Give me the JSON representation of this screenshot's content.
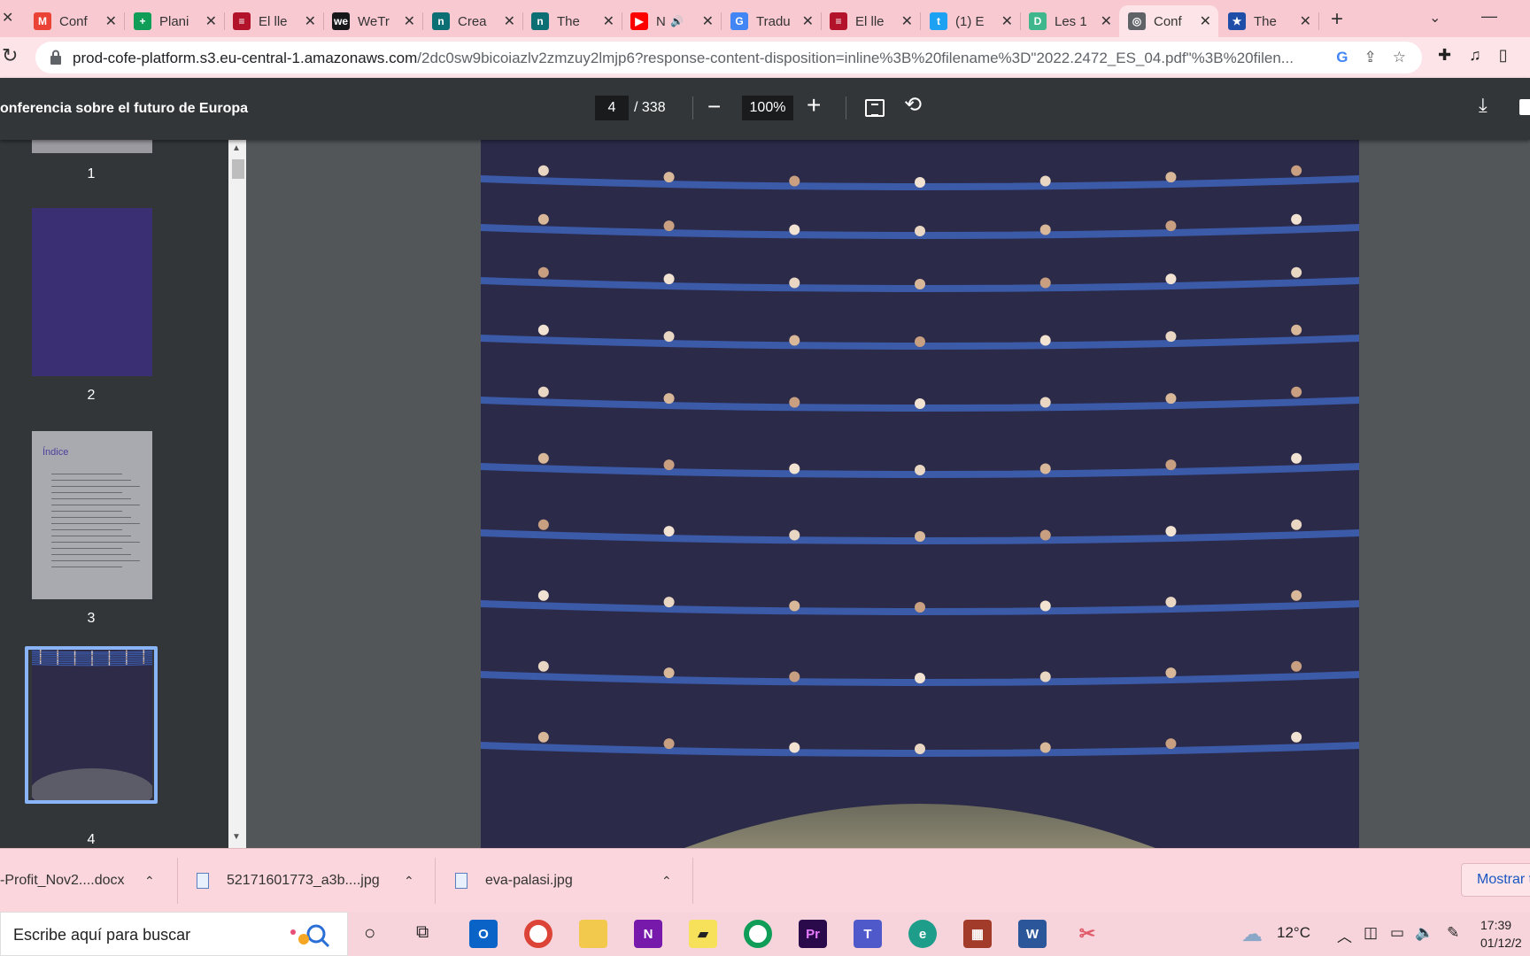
{
  "browser": {
    "tabs": [
      {
        "title": "Conf",
        "favicon": "gmail-icon",
        "color": "#ea4335",
        "glyph": "M"
      },
      {
        "title": "Plani",
        "favicon": "sheets-icon",
        "color": "#0f9d58",
        "glyph": "+"
      },
      {
        "title": "El lle",
        "favicon": "news-icon",
        "color": "#b3132a",
        "glyph": "≡"
      },
      {
        "title": "WeTr",
        "favicon": "wetransfer-icon",
        "color": "#17181a",
        "glyph": "we"
      },
      {
        "title": "Crea",
        "favicon": "notion-like-icon",
        "color": "#0b6f74",
        "glyph": "n"
      },
      {
        "title": "The",
        "favicon": "notion-like-icon",
        "color": "#0b6f74",
        "glyph": "n"
      },
      {
        "title": "N",
        "favicon": "youtube-icon",
        "color": "#ff0000",
        "glyph": "▶",
        "audio": "🔊"
      },
      {
        "title": "Tradu",
        "favicon": "translate-icon",
        "color": "#4285f4",
        "glyph": "G"
      },
      {
        "title": "El lle",
        "favicon": "news-icon",
        "color": "#b3132a",
        "glyph": "≡"
      },
      {
        "title": "(1) E",
        "favicon": "twitter-icon",
        "color": "#1da1f2",
        "glyph": "t"
      },
      {
        "title": "Les 1",
        "favicon": "doc-icon",
        "color": "#3fb68b",
        "glyph": "D"
      },
      {
        "title": "Conf",
        "favicon": "globe-icon",
        "color": "#5f6368",
        "glyph": "◎",
        "active": true
      },
      {
        "title": "The",
        "favicon": "eu-flag-icon",
        "color": "#1e4ea8",
        "glyph": "★"
      }
    ],
    "new_tab": "+",
    "url_host": "prod-cofe-platform.s3.eu-central-1.amazonaws.com",
    "url_path": "/2dc0sw9bicoiazlv2zmzuy2lmjp6?response-content-disposition=inline%3B%20filename%3D\"2022.2472_ES_04.pdf\"%3B%20filen..."
  },
  "pdf": {
    "title": "onferencia sobre el futuro de Europa",
    "current_page": "4",
    "total_pages": "/ 338",
    "zoom": "100%",
    "thumbnails": [
      "1",
      "2",
      "3",
      "4"
    ],
    "thumb3_heading": "Índice"
  },
  "downloads": [
    {
      "name": "-Profit_Nov2....docx"
    },
    {
      "name": "52171601773_a3b....jpg"
    },
    {
      "name": "eva-palasi.jpg"
    }
  ],
  "show_all": "Mostrar t",
  "taskbar": {
    "search_placeholder": "Escribe aquí para buscar",
    "temperature": "12°C",
    "time": "17:39",
    "date": "01/12/2"
  }
}
